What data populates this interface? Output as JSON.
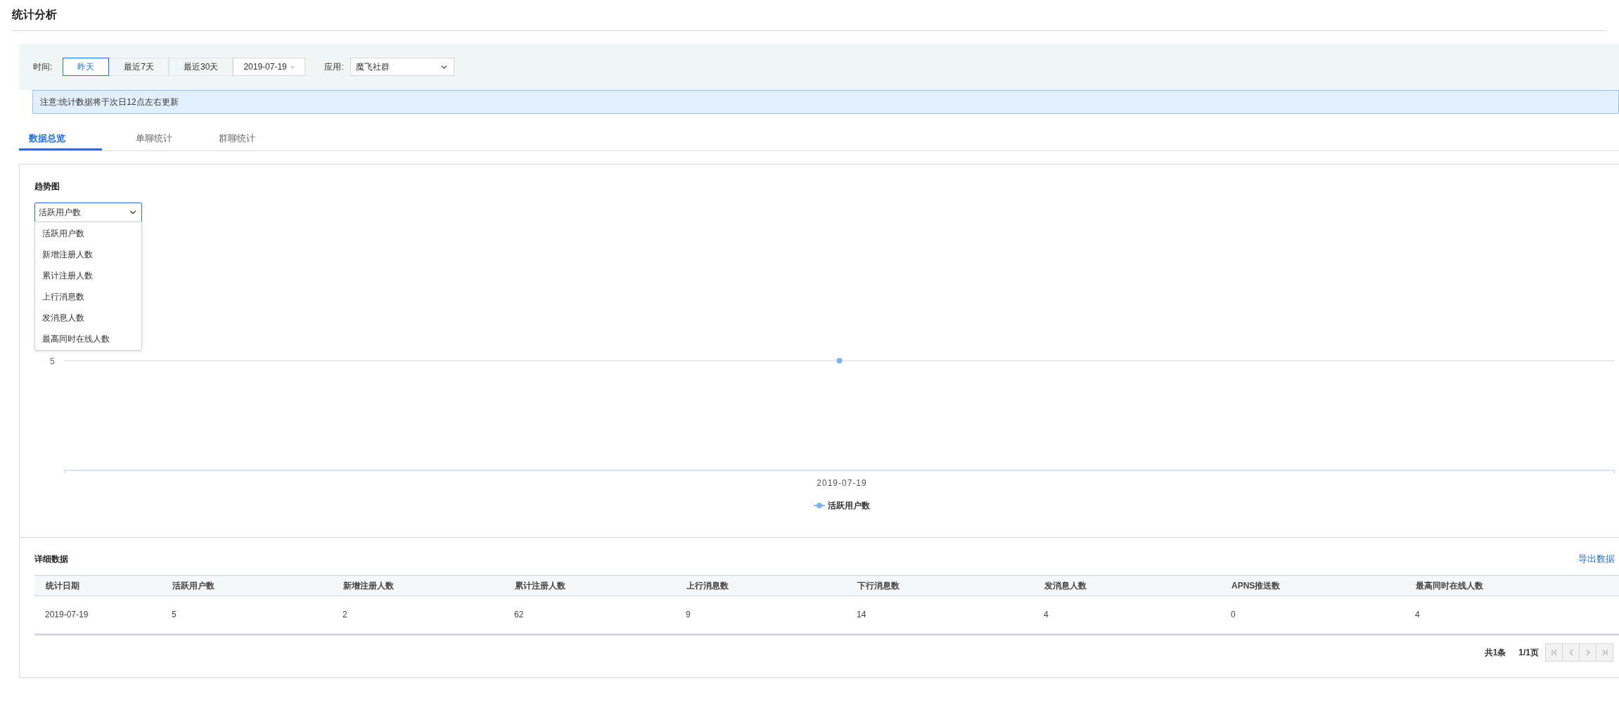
{
  "page_title": "统计分析",
  "filters": {
    "time_label": "时间:",
    "ranges": [
      {
        "label": "昨天",
        "selected": true
      },
      {
        "label": "最近7天",
        "selected": false
      },
      {
        "label": "最近30天",
        "selected": false
      }
    ],
    "date": "2019-07-19",
    "app_label": "应用:",
    "app": "魔飞社群"
  },
  "notice": "注意:统计数据将于次日12点左右更新",
  "tabs": [
    {
      "label": "数据总览",
      "selected": true
    },
    {
      "label": "单聊统计",
      "selected": false
    },
    {
      "label": "群聊统计",
      "selected": false
    }
  ],
  "trend": {
    "title": "趋势图",
    "metric_select": {
      "value": "活跃用户数",
      "open": true,
      "options": [
        "活跃用户数",
        "新增注册人数",
        "累计注册人数",
        "上行消息数",
        "发消息人数",
        "最高同时在线人数"
      ]
    },
    "chart": {
      "y_tick": "5",
      "x_label": "2019-07-19",
      "legend": "活跃用户数"
    }
  },
  "details": {
    "title": "详细数据",
    "export": "导出数据",
    "columns": [
      "统计日期",
      "活跃用户数",
      "新增注册人数",
      "累计注册人数",
      "上行消息数",
      "下行消息数",
      "发消息人数",
      "APNS推送数",
      "最高同时在线人数"
    ],
    "rows": [
      [
        "2019-07-19",
        "5",
        "2",
        "62",
        "9",
        "14",
        "4",
        "0",
        "4"
      ]
    ]
  },
  "pagination": {
    "total": "共1条",
    "page": "1/1页",
    "buttons": [
      {
        "kind": "first",
        "disabled": true
      },
      {
        "kind": "prev",
        "disabled": true
      },
      {
        "kind": "next",
        "disabled": true
      },
      {
        "kind": "last",
        "disabled": true
      }
    ]
  }
}
